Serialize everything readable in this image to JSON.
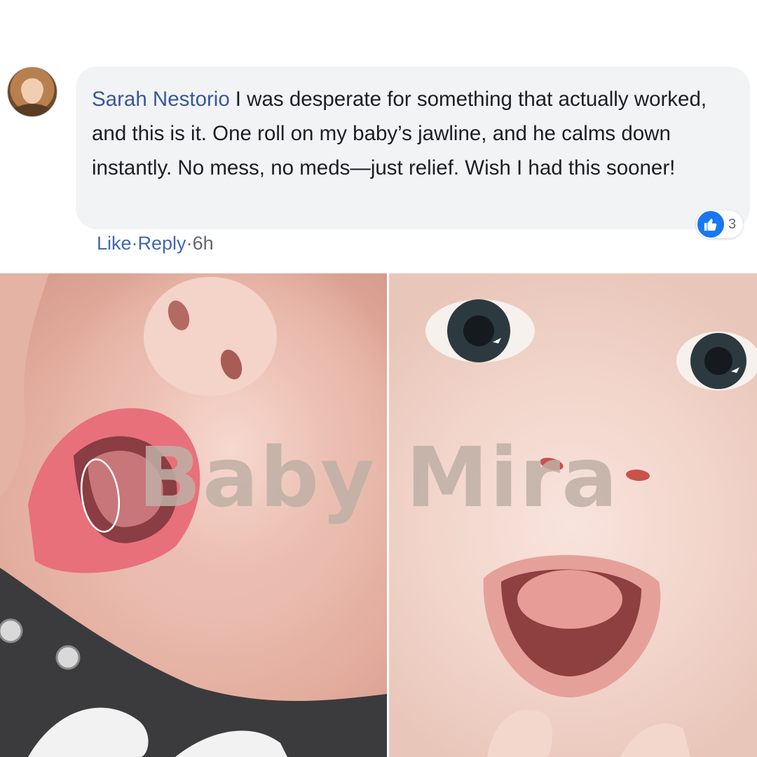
{
  "comment": {
    "author": "Sarah Nestorio",
    "text": "I was desperate for something that actually worked, and this is it. One roll on my baby’s jawline, and he calms down instantly. No mess, no meds—just relief. Wish I had this sooner!",
    "reaction_icon": "thumbs-up-icon",
    "reaction_count": "3",
    "actions": {
      "like": "Like",
      "separator": "·",
      "reply": "Reply",
      "time": "6h"
    }
  },
  "watermark": "Baby Mira",
  "colors": {
    "author_link": "#385898",
    "action_link": "#4267b2",
    "bubble_bg": "#f2f3f5",
    "like_badge": "#1877f2"
  }
}
